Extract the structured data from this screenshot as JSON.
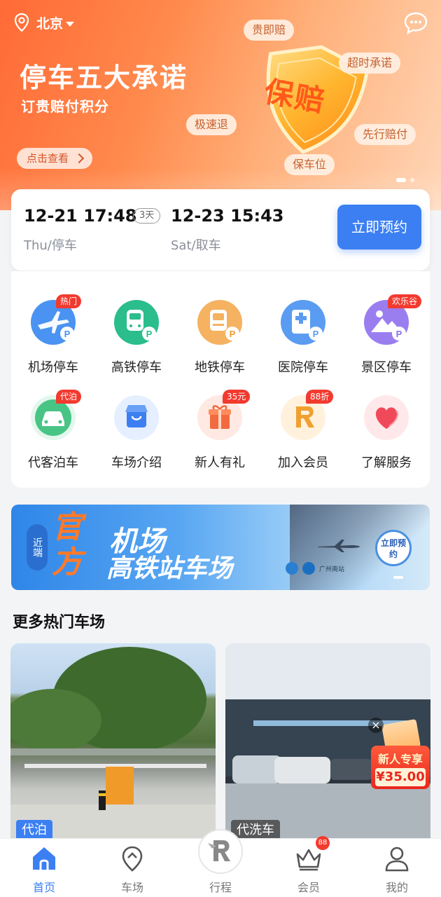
{
  "header": {
    "city": "北京",
    "hero_title": "停车五大承诺",
    "hero_subtitle": "订贵赔付积分",
    "hero_cta": "点击查看",
    "shield_text": "保赔",
    "promises": [
      "贵即赔",
      "超时承诺",
      "极速退",
      "先行赔付",
      "保车位"
    ]
  },
  "booking": {
    "start_datetime": "12-21 17:48",
    "start_day": "Thu/停车",
    "duration": "3天",
    "end_datetime": "12-23 15:43",
    "end_day": "Sat/取车",
    "book_button": "立即预约"
  },
  "services": [
    {
      "label": "机场停车",
      "badge": "热门",
      "icon": "airport-parking-icon",
      "color": "#3d8ef0"
    },
    {
      "label": "高铁停车",
      "badge": "",
      "icon": "highspeed-rail-parking-icon",
      "color": "#27b98a"
    },
    {
      "label": "地铁停车",
      "badge": "",
      "icon": "metro-parking-icon",
      "color": "#f0a44a"
    },
    {
      "label": "医院停车",
      "badge": "",
      "icon": "hospital-parking-icon",
      "color": "#4a8ff0"
    },
    {
      "label": "景区停车",
      "badge": "欢乐谷",
      "icon": "scenic-parking-icon",
      "color": "#8a6ee8"
    },
    {
      "label": "代客泊车",
      "badge": "代泊",
      "icon": "valet-parking-icon",
      "color": "#3fbf7a"
    },
    {
      "label": "车场介绍",
      "badge": "",
      "icon": "parking-lot-intro-icon",
      "color": "#3d7ff0"
    },
    {
      "label": "新人有礼",
      "badge": "35元",
      "icon": "gift-icon",
      "color": "#f0603a"
    },
    {
      "label": "加入会员",
      "badge": "88折",
      "icon": "membership-icon",
      "color": "#f09a2a"
    },
    {
      "label": "了解服务",
      "badge": "",
      "icon": "heart-icon",
      "color": "#f04a5a"
    }
  ],
  "promo_banner": {
    "near": "近端",
    "official": "官方",
    "line1": "机场",
    "line2": "高铁站车场",
    "cta": "立即预约",
    "logo_text": "广州南站"
  },
  "hot_lots": {
    "title": "更多热门车场",
    "items": [
      {
        "tag": "代泊"
      },
      {
        "tag": "代洗车"
      }
    ]
  },
  "newcomer": {
    "label": "新人专享",
    "amount": "¥35.00"
  },
  "tabbar": [
    {
      "label": "首页",
      "icon": "home-icon",
      "active": true
    },
    {
      "label": "车场",
      "icon": "location-icon",
      "active": false
    },
    {
      "label": "行程",
      "icon": "trip-icon",
      "active": false
    },
    {
      "label": "会员",
      "icon": "crown-icon",
      "active": false,
      "badge": "88"
    },
    {
      "label": "我的",
      "icon": "user-icon",
      "active": false
    }
  ],
  "colors": {
    "primary": "#3b7ff2",
    "hero_start": "#ff6a36",
    "badge_red": "#f23a2f"
  }
}
